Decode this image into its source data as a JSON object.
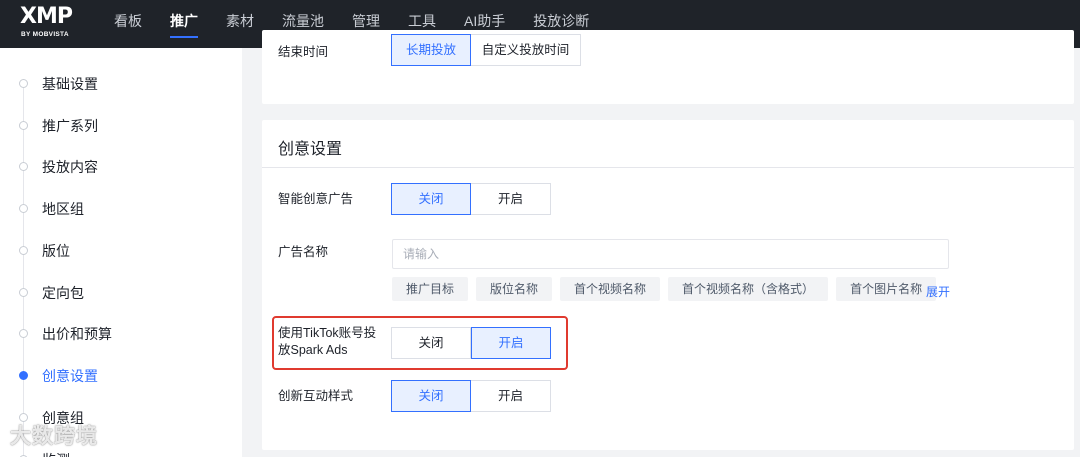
{
  "brand": {
    "name": "XMP",
    "sub": "BY MOBVISTA"
  },
  "nav": {
    "items": [
      "看板",
      "推广",
      "素材",
      "流量池",
      "管理",
      "工具",
      "AI助手",
      "投放诊断"
    ],
    "active": "推广"
  },
  "sidebar": {
    "items": [
      "基础设置",
      "推广系列",
      "投放内容",
      "地区组",
      "版位",
      "定向包",
      "出价和预算",
      "创意设置",
      "创意组",
      "监测"
    ],
    "active": "创意设置"
  },
  "end_time": {
    "label": "结束时间",
    "options": [
      "长期投放",
      "自定义投放时间"
    ],
    "selected": "长期投放"
  },
  "creative": {
    "title": "创意设置",
    "smart_ad": {
      "label": "智能创意广告",
      "options": [
        "关闭",
        "开启"
      ],
      "selected": "关闭"
    },
    "ad_name": {
      "label": "广告名称",
      "placeholder": "请输入",
      "value": "",
      "chips": [
        "推广目标",
        "版位名称",
        "首个视频名称",
        "首个视频名称（含格式）",
        "首个图片名称"
      ],
      "expand_label": "展开"
    },
    "spark_ads": {
      "label_line1": "使用TikTok账号投",
      "label_line2": "放Spark Ads",
      "options": [
        "关闭",
        "开启"
      ],
      "selected": "开启"
    },
    "interactive": {
      "label": "创新互动样式",
      "options": [
        "关闭",
        "开启"
      ],
      "selected": "关闭"
    }
  },
  "watermark": "大数跨境",
  "colors": {
    "accent": "#3370ff",
    "topbar": "#1f2329",
    "highlight": "#e03a2f"
  }
}
